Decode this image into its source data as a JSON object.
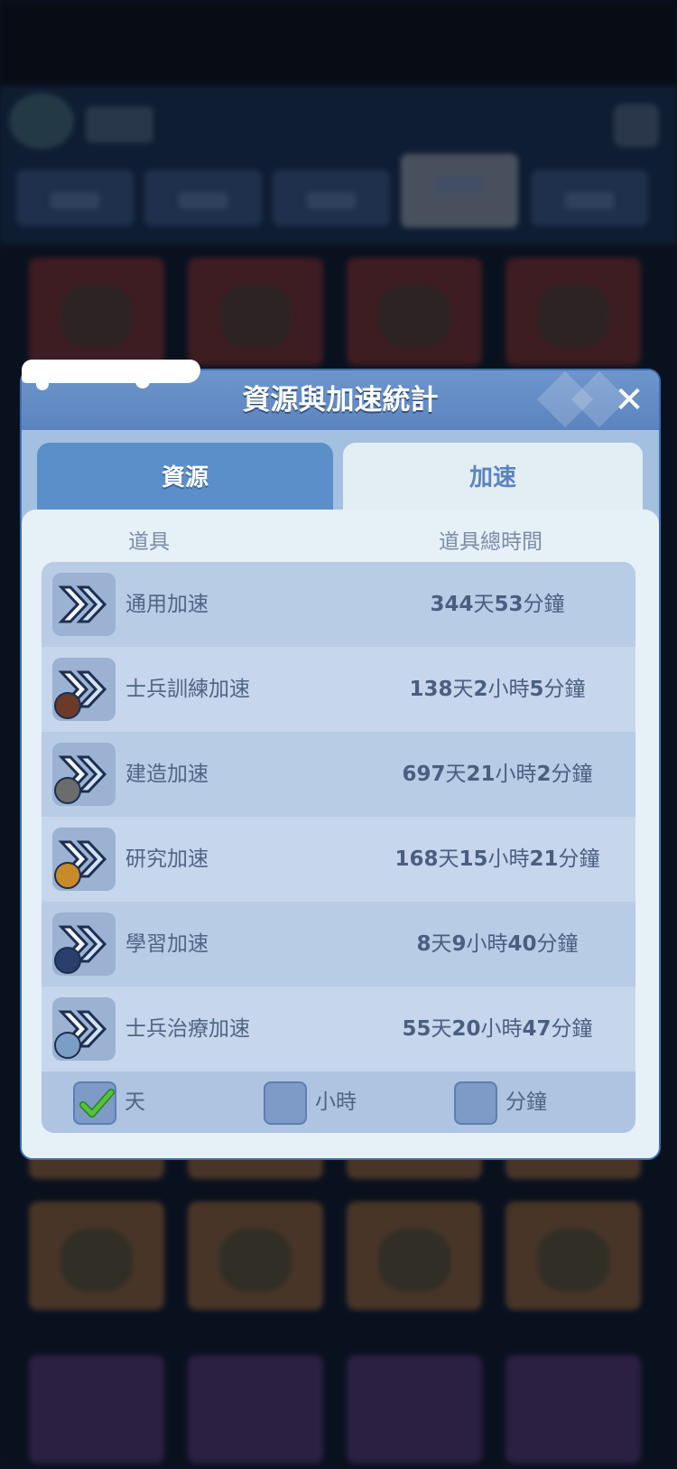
{
  "dialog": {
    "title": "資源與加速統計",
    "close_icon": "close-icon",
    "tabs": [
      {
        "label": "資源",
        "selected": true
      },
      {
        "label": "加速",
        "selected": false
      }
    ],
    "columns": {
      "item": "道具",
      "total_time": "道具總時間"
    },
    "rows": [
      {
        "label": "通用加速",
        "icon": "speedup-general-icon",
        "time_parts": [
          [
            "344",
            "天"
          ],
          [
            "53",
            "分鐘"
          ]
        ]
      },
      {
        "label": "士兵訓練加速",
        "icon": "speedup-training-icon",
        "time_parts": [
          [
            "138",
            "天"
          ],
          [
            "2",
            "小時"
          ],
          [
            "5",
            "分鐘"
          ]
        ]
      },
      {
        "label": "建造加速",
        "icon": "speedup-building-icon",
        "time_parts": [
          [
            "697",
            "天"
          ],
          [
            "21",
            "小時"
          ],
          [
            "2",
            "分鐘"
          ]
        ]
      },
      {
        "label": "研究加速",
        "icon": "speedup-research-icon",
        "time_parts": [
          [
            "168",
            "天"
          ],
          [
            "15",
            "小時"
          ],
          [
            "21",
            "分鐘"
          ]
        ]
      },
      {
        "label": "學習加速",
        "icon": "speedup-learning-icon",
        "time_parts": [
          [
            "8",
            "天"
          ],
          [
            "9",
            "小時"
          ],
          [
            "40",
            "分鐘"
          ]
        ]
      },
      {
        "label": "士兵治療加速",
        "icon": "speedup-healing-icon",
        "time_parts": [
          [
            "55",
            "天"
          ],
          [
            "20",
            "小時"
          ],
          [
            "47",
            "分鐘"
          ]
        ]
      }
    ],
    "units": [
      {
        "label": "天",
        "checked": true
      },
      {
        "label": "小時",
        "checked": false
      },
      {
        "label": "分鐘",
        "checked": false
      }
    ]
  },
  "colors": {
    "accent": "#5b84bf",
    "tab_selected": "#5b8fca",
    "check_green": "#3fae2f"
  }
}
